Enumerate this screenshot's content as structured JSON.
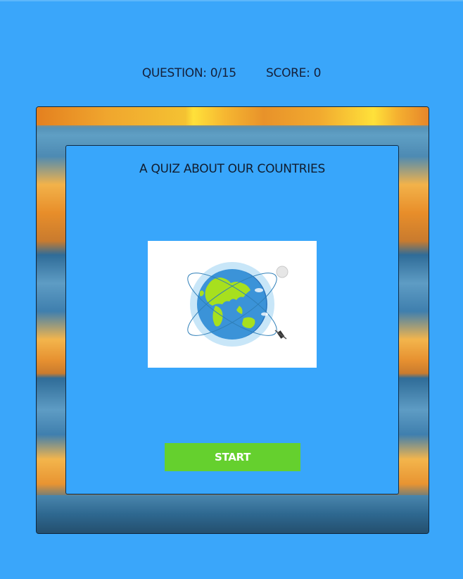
{
  "header": {
    "question_label": "QUESTION: 0/15",
    "score_label": "SCORE: 0"
  },
  "quiz": {
    "title": "A QUIZ ABOUT OUR COUNTRIES",
    "start_label": "START"
  },
  "colors": {
    "background": "#3aa6fa",
    "panel": "#38a6fb",
    "start_button": "#65d02e"
  }
}
